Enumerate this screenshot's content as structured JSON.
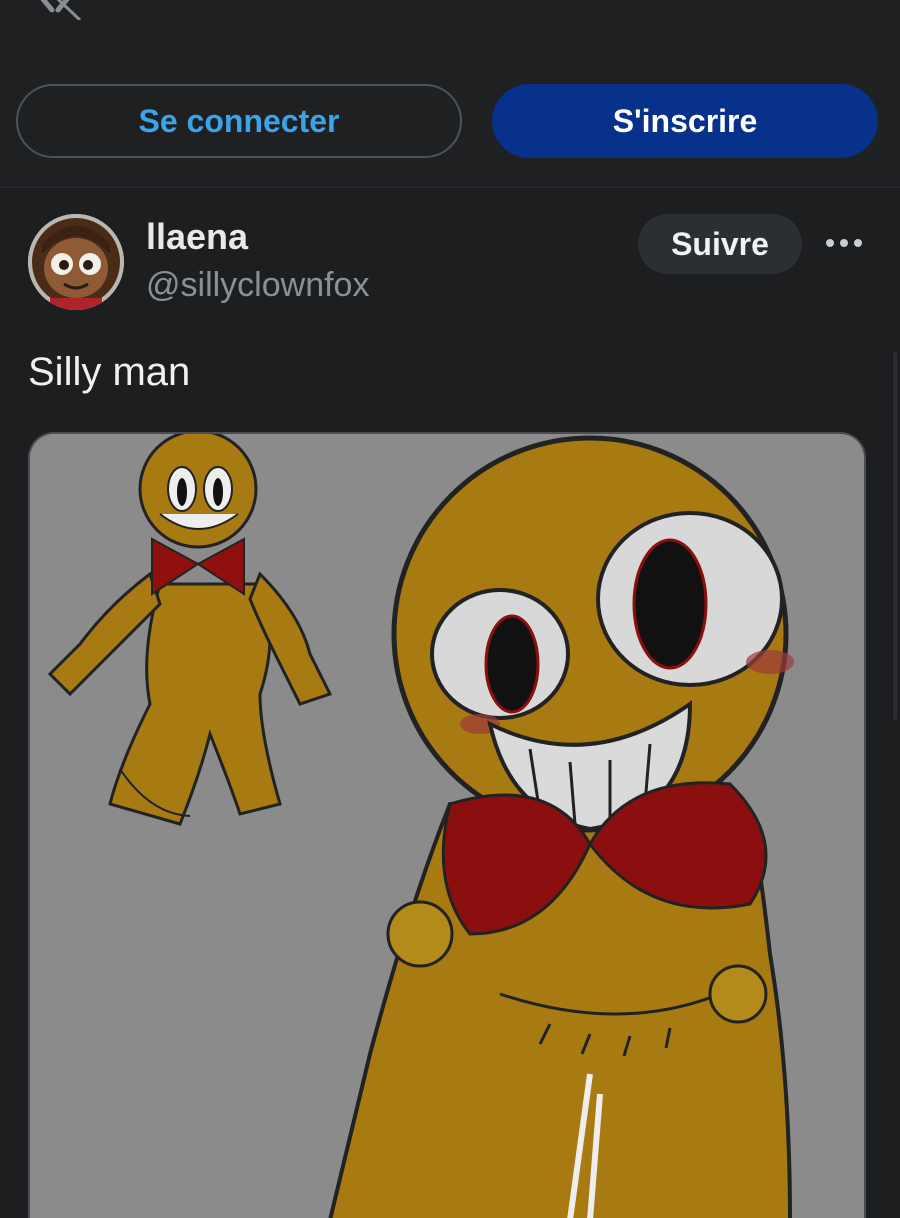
{
  "header": {
    "logo_icon": "x-logo-icon",
    "login_label": "Se connecter",
    "signup_label": "S'inscrire"
  },
  "post": {
    "author_name": "llaena",
    "author_handle": "@sillyclownfox",
    "follow_label": "Suivre",
    "more_icon": "more-options-icon",
    "text": "Silly man",
    "media": {
      "type": "image",
      "subject": "drawing of a yellow patchwork doll character with a red bow"
    }
  },
  "colors": {
    "background": "#1d1e20",
    "login_text": "#3ba3e6",
    "signup_bg": "#07318a",
    "follow_bg": "#2b2e32"
  }
}
